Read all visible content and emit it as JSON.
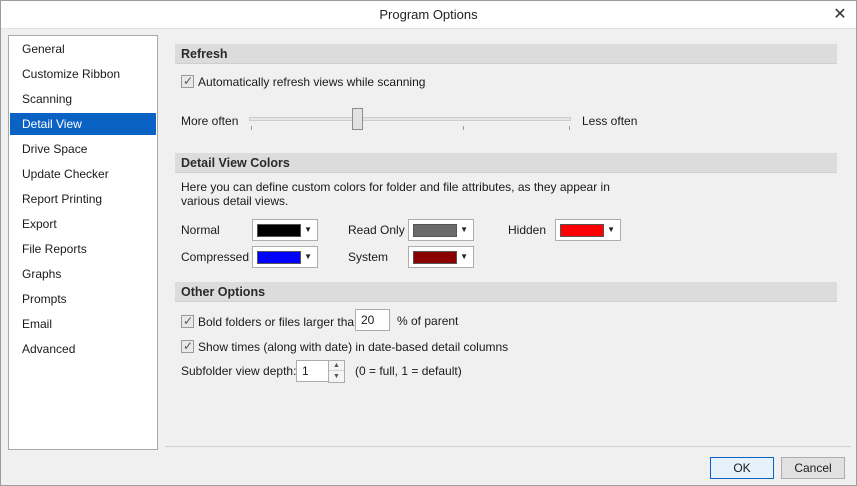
{
  "window": {
    "title": "Program Options",
    "close_glyph": "✕"
  },
  "sidebar": {
    "items": [
      {
        "label": "General"
      },
      {
        "label": "Customize Ribbon"
      },
      {
        "label": "Scanning"
      },
      {
        "label": "Detail View",
        "selected": true
      },
      {
        "label": "Drive Space"
      },
      {
        "label": "Update Checker"
      },
      {
        "label": "Report Printing"
      },
      {
        "label": "Export"
      },
      {
        "label": "File Reports"
      },
      {
        "label": "Graphs"
      },
      {
        "label": "Prompts"
      },
      {
        "label": "Email"
      },
      {
        "label": "Advanced"
      }
    ]
  },
  "refresh": {
    "header": "Refresh",
    "auto_refresh_label": "Automatically refresh views while scanning",
    "auto_refresh_checked": true,
    "more_often": "More often",
    "less_often": "Less often",
    "slider_value_fraction": 0.33
  },
  "colors": {
    "header": "Detail View Colors",
    "description": "Here you can define custom colors for folder and file attributes, as they appear in various detail views.",
    "normal_label": "Normal",
    "normal_color": "#000000",
    "read_only_label": "Read Only",
    "read_only_color": "#6b6b6b",
    "hidden_label": "Hidden",
    "hidden_color": "#ff0000",
    "compressed_label": "Compressed",
    "compressed_color": "#0000ff",
    "system_label": "System",
    "system_color": "#8b0000",
    "dropdown_icon": "chevron-down-icon"
  },
  "other": {
    "header": "Other Options",
    "bold_label": "Bold folders or files larger than",
    "bold_checked": true,
    "bold_value": "20",
    "bold_suffix": "% of parent",
    "show_times_label": "Show times (along with date) in date-based detail columns",
    "show_times_checked": true,
    "depth_label": "Subfolder view depth:",
    "depth_value": "1",
    "depth_hint": "(0 = full, 1 = default)"
  },
  "buttons": {
    "ok": "OK",
    "cancel": "Cancel"
  }
}
